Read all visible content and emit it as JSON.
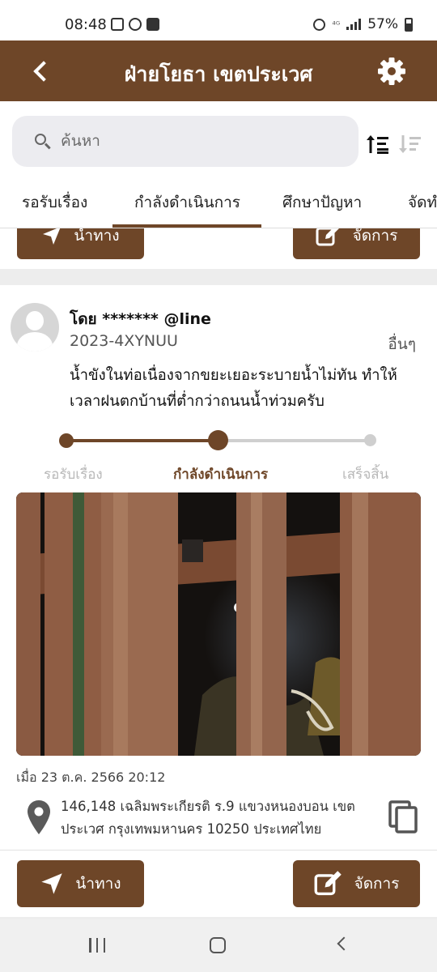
{
  "status_bar": {
    "time": "08:48",
    "battery": "57%"
  },
  "header": {
    "title": "ฝ่ายโยธา เขตประเวศ"
  },
  "search": {
    "placeholder": "ค้นหา",
    "value": ""
  },
  "tabs": [
    {
      "label": "รอรับเรื่อง",
      "active": false
    },
    {
      "label": "กำลังดำเนินการ",
      "active": true
    },
    {
      "label": "ศึกษาปัญหา",
      "active": false
    },
    {
      "label": "จัดทำ",
      "active": false
    }
  ],
  "prev_card": {
    "navigate_label": "นำทาง",
    "manage_label": "จัดการ"
  },
  "card": {
    "reporter": "โดย ******* @line",
    "ticket_id": "2023-4XYNUU",
    "category": "อื่นๆ",
    "description": "น้ำขังในท่อเนื่องจากขยะเยอะระบายน้ำไม่ทัน ทำให้เวลาฝนตกบ้านที่ต่ำกว่าถนนน้ำท่วมครับ",
    "steps": [
      {
        "label": "รอรับเรื่อง",
        "state": "done"
      },
      {
        "label": "กำลังดำเนินการ",
        "state": "current"
      },
      {
        "label": "เสร็จสิ้น",
        "state": "pending"
      }
    ],
    "progress_fraction": 0.5,
    "timestamp": "เมื่อ 23 ต.ค. 2566 20:12",
    "address": "146,148 เฉลิมพระเกียรติ ร.9 แขวงหนองบอน เขตประเวศ กรุงเทพมหานคร 10250 ประเทศไทย",
    "navigate_label": "นำทาง",
    "manage_label": "จัดการ"
  },
  "colors": {
    "brand": "#6e4628",
    "inactive_step": "#cfcfcf",
    "inactive_label": "#b8b8b8"
  }
}
